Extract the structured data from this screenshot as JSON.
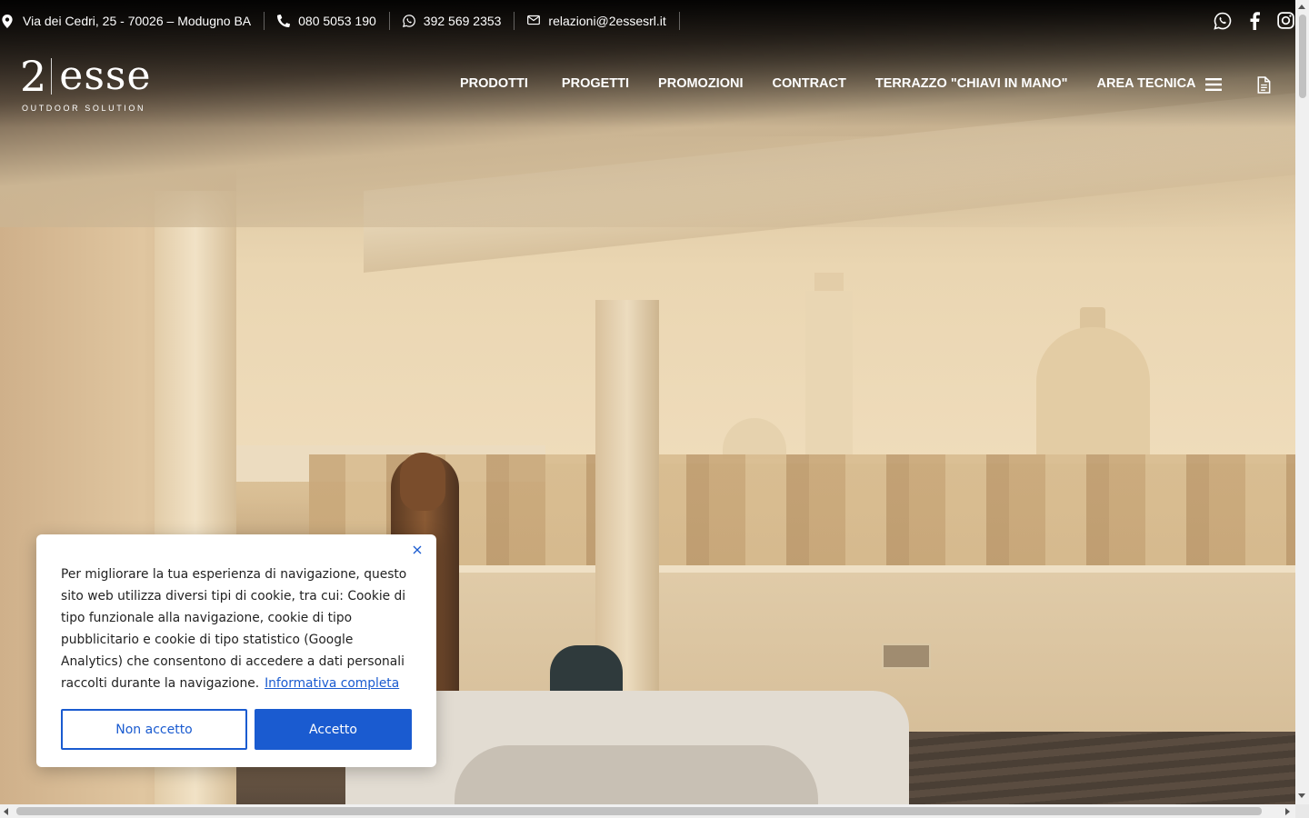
{
  "topbar": {
    "address": "Via dei Cedri, 25 - 70026 – Modugno BA",
    "phone": "080 5053 190",
    "whatsapp": "392 569 2353",
    "email": "relazioni@2essesrl.it",
    "social_icons": [
      "whatsapp-icon",
      "facebook-icon",
      "instagram-icon"
    ]
  },
  "logo": {
    "number": "2",
    "name": "esse",
    "tagline": "OUTDOOR SOLUTION"
  },
  "nav": {
    "items": [
      "PRODOTTI",
      "PROGETTI",
      "PROMOZIONI",
      "CONTRACT",
      "TERRAZZO \"CHIAVI IN MANO\"",
      "AREA TECNICA"
    ],
    "icons": [
      "menu-icon",
      "document-icon"
    ]
  },
  "cookie": {
    "text": "Per migliorare la tua esperienza di navigazione, questo sito web utilizza diversi tipi di cookie, tra cui: Cookie di tipo funzionale alla navigazione, cookie di tipo pubblicitario e cookie di tipo statistico (Google Analytics) che consentono di accedere a dati personali raccolti durante la navigazione.",
    "link": "Informativa completa",
    "reject": "Non accetto",
    "accept": "Accetto",
    "accent_color": "#1a5bd0"
  }
}
